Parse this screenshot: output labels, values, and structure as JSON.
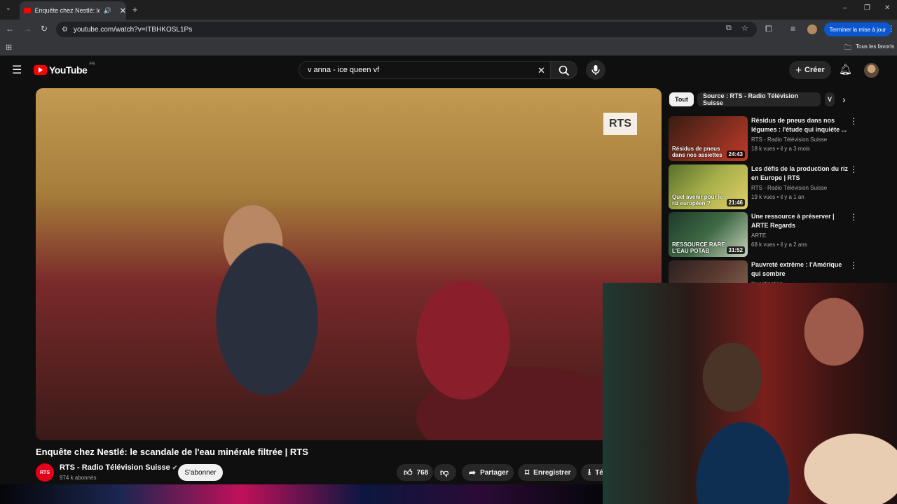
{
  "browser": {
    "tab_title": "Enquête chez Nestlé: le scandale de l'eau minérale filtrée | RTS",
    "url": "youtube.com/watch?v=ITBHKOSL1Ps",
    "update_button": "Terminer la mise à jour",
    "bookmarks_label": "Tous les favoris"
  },
  "header": {
    "logo_text": "YouTube",
    "region": "FR",
    "search_query": "v anna - ice queen vf",
    "create_label": "Créer"
  },
  "video": {
    "watermark": "RTS",
    "title": "Enquête chez Nestlé: le scandale de l'eau minérale filtrée | RTS",
    "channel_avatar_text": "RTS",
    "channel_name": "RTS - Radio Télévision Suisse",
    "subscribers": "974 k abonnés",
    "subscribe_label": "S'abonner",
    "likes": "768",
    "share_label": "Partager",
    "save_label": "Enregistrer",
    "more_label": "Té"
  },
  "filters": {
    "chip_all": "Tout",
    "chip_source": "Source : RTS - Radio Télévision Suisse",
    "chip_next": "V"
  },
  "related": [
    {
      "title": "Résidus de pneus dans nos légumes : l'étude qui inquiète ...",
      "channel": "RTS - Radio Télévision Suisse",
      "meta": "18 k vues • il y a 3 mois",
      "duration": "24:43",
      "overlay": "Résidus de pneus dans nos assiettes",
      "colors": [
        "#3a1c12",
        "#7b2c1e",
        "#c23a2a"
      ]
    },
    {
      "title": "Les défis de la production du riz en Europe | RTS",
      "channel": "RTS - Radio Télévision Suisse",
      "meta": "19 k vues • il y a 1 an",
      "duration": "21:46",
      "overlay": "Quel avenir pour le riz européen ?",
      "colors": [
        "#5a6e2c",
        "#a8b04a",
        "#e2cf6a"
      ]
    },
    {
      "title": "Une ressource à préserver | ARTE Regards",
      "channel": "ARTE",
      "meta": "68 k vues • il y a 2 ans",
      "duration": "31:52",
      "overlay": "RESSOURCE RARE: L'EAU POTAB",
      "colors": [
        "#1e3a2a",
        "#3f6a44",
        "#c8d0bc"
      ]
    },
    {
      "title": "Pauvreté extrême : l'Amérique qui sombre",
      "channel": "Investigation",
      "meta": "",
      "duration": "",
      "overlay": "",
      "colors": [
        "#2a2020",
        "#5a3a30",
        "#8a6a58"
      ]
    }
  ],
  "colors": {
    "accent": "#ff0000",
    "update_blue": "#0b57d0",
    "bg": "#0f0f0f"
  }
}
